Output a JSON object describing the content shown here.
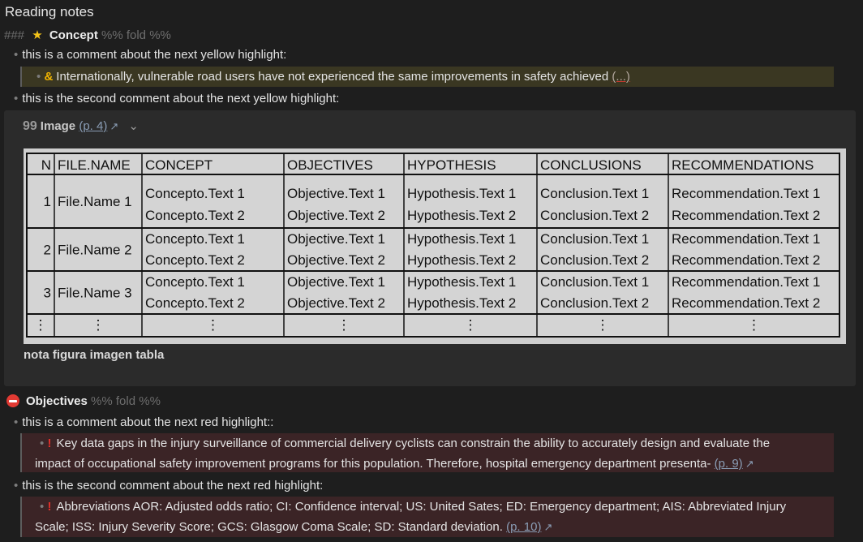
{
  "title": "Reading notes",
  "concept_heading": {
    "hashes": "###",
    "label": "Concept",
    "fold": "%% fold %%"
  },
  "yellow_comment_1": "this is a comment about the next yellow highlight:",
  "yellow_highlight": {
    "marker": "&",
    "text": "Internationally, vulnerable road users have not experienced the same improvements in safety achieved",
    "more": "(...)"
  },
  "yellow_comment_2": "this is the second comment about the next yellow highlight:",
  "image_block": {
    "quote_icon": "99",
    "label": "Image",
    "page_link": "(p. 4)",
    "caption": "nota figura imagen tabla"
  },
  "table": {
    "headers": [
      "N",
      "FILE.NAME",
      "CONCEPT",
      "OBJECTIVES",
      "HYPOTHESIS",
      "CONCLUSIONS",
      "RECOMMENDATIONS"
    ],
    "rows": [
      {
        "n": "1",
        "file": "File.Name 1",
        "concept": [
          "Concepto.Text 1",
          "Concepto.Text 2"
        ],
        "objectives": [
          "Objective.Text 1",
          "Objective.Text 2"
        ],
        "hypothesis": [
          "Hypothesis.Text 1",
          "Hypothesis.Text 2"
        ],
        "conclusions": [
          "Conclusion.Text 1",
          "Conclusion.Text 2"
        ],
        "recommendations": [
          "Recommendation.Text 1",
          "Recommendation.Text 2"
        ]
      },
      {
        "n": "2",
        "file": "File.Name 2",
        "concept": [
          "Concepto.Text 1",
          "Concepto.Text 2"
        ],
        "objectives": [
          "Objective.Text 1",
          "Objective.Text 2"
        ],
        "hypothesis": [
          "Hypothesis.Text 1",
          "Hypothesis.Text 2"
        ],
        "conclusions": [
          "Conclusion.Text 1",
          "Conclusion.Text 2"
        ],
        "recommendations": [
          "Recommendation.Text 1",
          "Recommendation.Text 2"
        ]
      },
      {
        "n": "3",
        "file": "File.Name 3",
        "concept": [
          "Concepto.Text 1",
          "Concepto.Text 2"
        ],
        "objectives": [
          "Objective.Text 1",
          "Objective.Text 2"
        ],
        "hypothesis": [
          "Hypothesis.Text 1",
          "Hypothesis.Text 2"
        ],
        "conclusions": [
          "Conclusion.Text 1",
          "Conclusion.Text 2"
        ],
        "recommendations": [
          "Recommendation.Text 1",
          "Recommendation.Text 2"
        ]
      }
    ],
    "ellipsis": "⋮"
  },
  "objectives_heading": {
    "label": "Objectives",
    "fold": "%% fold %%"
  },
  "red_comment_1": "this is a comment about the next red highlight::",
  "red_highlight_1": {
    "marker": "!",
    "line1": "Key data gaps in the injury surveillance of commercial delivery cyclists can constrain the ability to accurately design and evaluate the",
    "line2": "impact of occupational safety improvement programs for this population. Therefore, hospital emergency department presenta-",
    "page_link": "(p. 9)"
  },
  "red_comment_2": "this is the second comment about the next red highlight:",
  "red_highlight_2": {
    "marker": "!",
    "line1": "Abbreviations AOR: Adjusted odds ratio; CI: Confidence interval; US: United Sates; ED: Emergency department; AIS: Abbreviated Injury",
    "line2": "Scale; ISS: Injury Severity Score; GCS: Glasgow Coma Scale; SD: Standard deviation.",
    "page_link": "(p. 10)"
  },
  "colors": {
    "background": "#1e1e1e",
    "yellow_highlight": "#3a3722",
    "red_highlight": "#3b2426",
    "star": "#f3c319",
    "stop": "#e23a33",
    "link": "#8a9db5"
  },
  "icons": {
    "star": "star-icon",
    "stop": "no-entry-icon",
    "quote": "quote-icon",
    "external": "external-link-icon",
    "chevron": "chevron-down-icon"
  }
}
